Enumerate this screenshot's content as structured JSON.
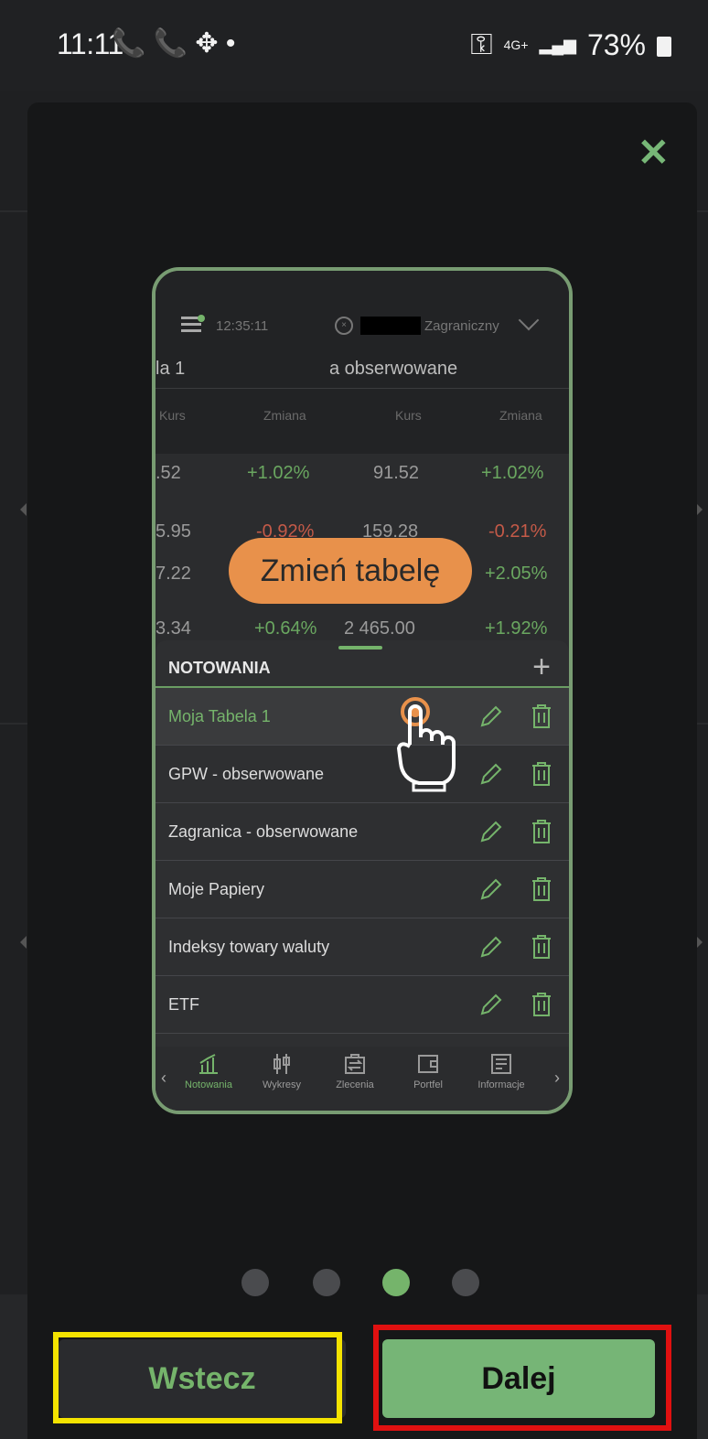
{
  "status_bar": {
    "time": "11:11",
    "icons_left": "📞 📞 ✥ •",
    "network": "4G+",
    "battery": "73%"
  },
  "modal": {
    "close_label": "✕",
    "preview": {
      "header_time": "12:35:11",
      "market_label": "Zagraniczny",
      "tab1": "la 1",
      "tab2": "a obserwowane",
      "col_headers": [
        "Kurs",
        "Zmiana",
        "Kurs",
        "Zmiana"
      ],
      "rows": [
        {
          "k1": ".52",
          "z1": "+1.02%",
          "k2": "91.52",
          "z2": "+1.02%",
          "s1": "pos",
          "s2": "pos"
        },
        {
          "k1": "5.95",
          "z1": "-0.92%",
          "k2": "159.28",
          "z2": "-0.21%",
          "s1": "neg",
          "s2": "neg"
        },
        {
          "k1": "7.22",
          "z1": "",
          "k2": "",
          "z2": "+2.05%",
          "s1": "neu",
          "s2": "pos"
        },
        {
          "k1": "3.34",
          "z1": "+0.64%",
          "k2": "2 465.00",
          "z2": "+1.92%",
          "s1": "pos",
          "s2": "pos"
        }
      ],
      "tooltip": "Zmień tabelę",
      "sheet_title": "NOTOWANIA",
      "sheet_add": "+",
      "tables": [
        "Moja Tabela 1",
        "GPW - obserwowane",
        "Zagranica - obserwowane",
        "Moje Papiery",
        "Indeksy towary waluty",
        "ETF"
      ],
      "nav": [
        "Notowania",
        "Wykresy",
        "Zlecenia",
        "Portfel",
        "Informacje"
      ]
    },
    "pager": {
      "count": 4,
      "active_index": 2
    },
    "back_label": "Wstecz",
    "next_label": "Dalej"
  },
  "colors": {
    "accent": "#75b46b",
    "tooltip": "#e8914b",
    "highlight_back": "#f4e300",
    "highlight_next": "#e01010"
  }
}
